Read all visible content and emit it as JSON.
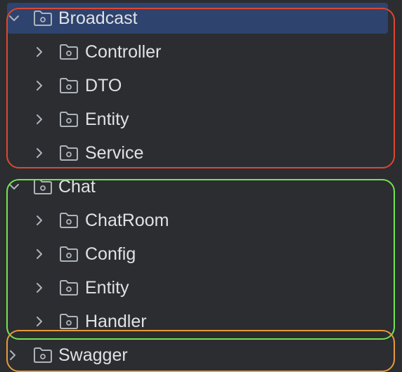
{
  "tree": {
    "broadcast": {
      "label": "Broadcast",
      "expanded": true,
      "selected": true,
      "children": [
        {
          "label": "Controller"
        },
        {
          "label": "DTO"
        },
        {
          "label": "Entity"
        },
        {
          "label": "Service"
        }
      ]
    },
    "chat": {
      "label": "Chat",
      "expanded": true,
      "children": [
        {
          "label": "ChatRoom"
        },
        {
          "label": "Config"
        },
        {
          "label": "Entity"
        },
        {
          "label": "Handler"
        }
      ]
    },
    "swagger": {
      "label": "Swagger",
      "expanded": false
    }
  },
  "annotations": {
    "box_colors": {
      "broadcast": "#e0462f",
      "chat": "#74e44d",
      "swagger": "#e89a3a"
    }
  },
  "colors": {
    "background": "#2b2d31",
    "selection": "#2e436e",
    "text": "#dfe1e5",
    "icon": "#aeb3bb"
  },
  "icons": {
    "expanded": "chevron-down-icon",
    "collapsed": "chevron-right-icon",
    "folder": "package-folder-icon"
  }
}
